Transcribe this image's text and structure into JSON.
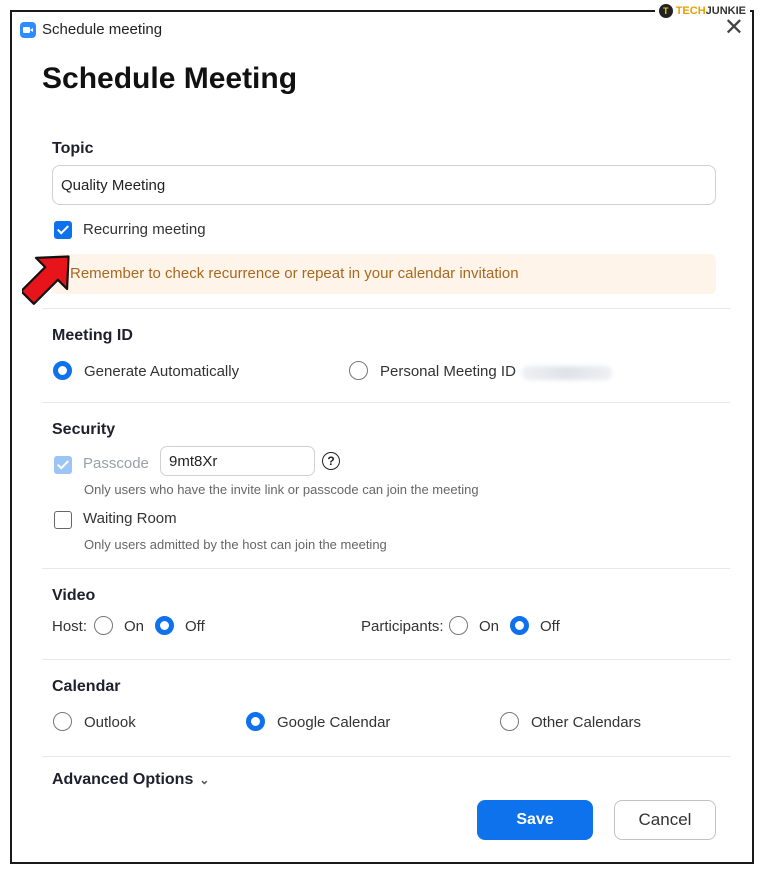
{
  "window": {
    "title": "Schedule meeting",
    "close_glyph": "✕"
  },
  "watermark": {
    "logo_letter": "T",
    "brand_a": "TECH",
    "brand_b": "JUNKIE"
  },
  "heading": "Schedule Meeting",
  "topic": {
    "label": "Topic",
    "value": "Quality Meeting"
  },
  "recurring": {
    "label": "Recurring meeting",
    "checked": true,
    "notice": "Remember to check recurrence or repeat in your calendar invitation"
  },
  "meeting_id": {
    "label": "Meeting ID",
    "options": [
      "Generate Automatically",
      "Personal Meeting ID"
    ],
    "selected": "Generate Automatically"
  },
  "security": {
    "label": "Security",
    "passcode_label": "Passcode",
    "passcode_value": "9mt8Xr",
    "help_glyph": "?",
    "passcode_hint": "Only users who have the invite link or passcode can join the meeting",
    "waiting_room_label": "Waiting Room",
    "waiting_room_hint": "Only users admitted by the host can join the meeting"
  },
  "video": {
    "label": "Video",
    "host_label": "Host:",
    "participants_label": "Participants:",
    "on": "On",
    "off": "Off",
    "host_selected": "Off",
    "participants_selected": "Off"
  },
  "calendar": {
    "label": "Calendar",
    "options": [
      "Outlook",
      "Google Calendar",
      "Other Calendars"
    ],
    "selected": "Google Calendar"
  },
  "advanced": {
    "label": "Advanced Options",
    "chevron": "⌄"
  },
  "buttons": {
    "save": "Save",
    "cancel": "Cancel"
  },
  "colors": {
    "accent": "#0E72ED",
    "notice_bg": "#FFF4EA",
    "notice_text": "#A8681E",
    "annotation_arrow": "#E8141B"
  },
  "annotation": {
    "arrow_icon": "red-arrow-icon"
  }
}
